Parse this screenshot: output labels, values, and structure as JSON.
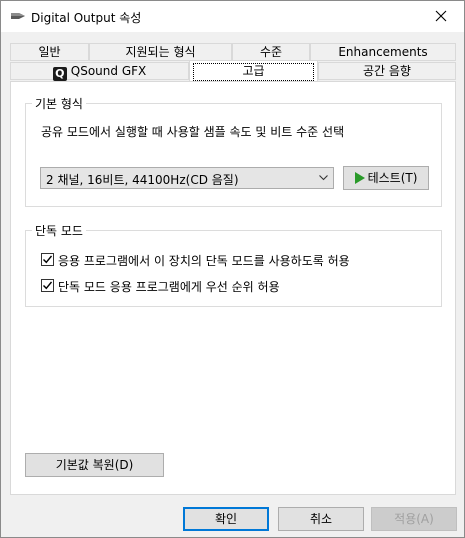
{
  "window": {
    "title": "Digital Output 속성"
  },
  "tabs": {
    "row1": [
      "일반",
      "지원되는 형식",
      "수준",
      "Enhancements"
    ],
    "row2": [
      "QSound GFX",
      "고급",
      "공간 음향"
    ],
    "qsound_icon_letter": "Q"
  },
  "default_format": {
    "title": "기본 형식",
    "description": "공유 모드에서 실행할 때 사용할 샘플 속도 및 비트 수준 선택",
    "selected": "2 채널, 16비트, 44100Hz(CD 음질)",
    "test_button": "테스트(T)"
  },
  "exclusive": {
    "title": "단독 모드",
    "option1": "응용 프로그램에서 이 장치의 단독 모드를 사용하도록 허용",
    "option1_checked": true,
    "option2": "단독 모드 응용 프로그램에게 우선 순위 허용",
    "option2_checked": true
  },
  "restore_button": "기본값 복원(D)",
  "footer": {
    "ok": "확인",
    "cancel": "취소",
    "apply": "적용(A)"
  },
  "colors": {
    "play_icon": "#2a9a2a",
    "focus_border": "#0078d7"
  },
  "icons": {
    "speaker": "speaker-icon",
    "close": "close-icon",
    "play": "play-icon",
    "dropdown": "chevron-down-icon",
    "check": "check-icon"
  }
}
